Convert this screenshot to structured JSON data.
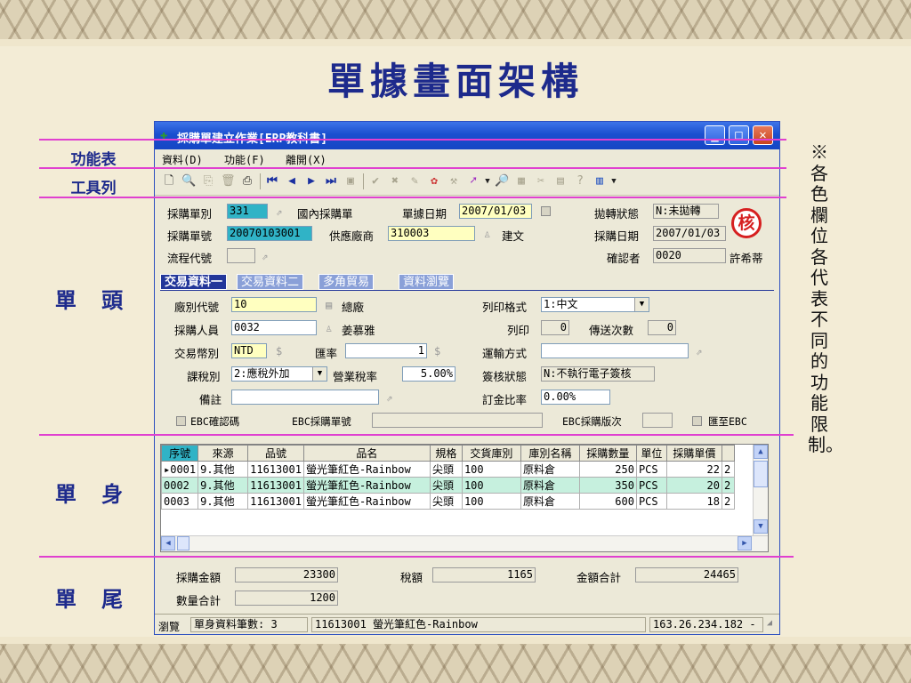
{
  "slide": {
    "title": "單據畫面架構",
    "labels": {
      "menu": "功能表",
      "toolbar": "工具列",
      "header": "單 頭",
      "body": "單 身",
      "footer": "單 尾"
    },
    "note": "※各色欄位各代表不同的功能限制。"
  },
  "window": {
    "title": "採購單建立作業[ERP教科書]",
    "menu": [
      "資料(D)",
      "功能(F)",
      "離開(X)"
    ]
  },
  "header": {
    "order_type_label": "採購單別",
    "order_type": "331",
    "order_type_name": "國內採購單",
    "doc_date_label": "單據日期",
    "doc_date": "2007/01/03",
    "transfer_label": "拋轉狀態",
    "transfer": "N:未拋轉",
    "order_no_label": "採購單號",
    "order_no": "20070103001",
    "vendor_label": "供應廠商",
    "vendor": "310003",
    "vendor_name": "建文",
    "purchase_date_label": "採購日期",
    "purchase_date": "2007/01/03",
    "flow_label": "流程代號",
    "flow": "",
    "confirmer_label": "確認者",
    "confirmer": "0020",
    "confirmer_name": "許希蒂",
    "stamp": "核"
  },
  "tabs": [
    "交易資料一",
    "交易資料二",
    "多角貿易",
    "資料瀏覽"
  ],
  "tab1": {
    "factory_label": "廠別代號",
    "factory": "10",
    "factory_name": "總廠",
    "buyer_label": "採購人員",
    "buyer": "0032",
    "buyer_name": "姜慕雅",
    "currency_label": "交易幣別",
    "currency": "NTD",
    "rate_label": "匯率",
    "rate": "1",
    "tax_type_label": "課稅別",
    "tax_type": "2:應稅外加",
    "tax_rate_label": "營業稅率",
    "tax_rate": "5.00%",
    "remark_label": "備註",
    "remark": "",
    "print_format_label": "列印格式",
    "print_format": "1:中文",
    "print_label": "列印",
    "print_count": "0",
    "send_label": "傳送次數",
    "send_count": "0",
    "shipping_label": "運輸方式",
    "shipping": "",
    "sign_label": "簽核狀態",
    "sign": "N:不執行電子簽核",
    "deposit_label": "訂金比率",
    "deposit": "0.00%",
    "ebc_code_label": "EBC確認碼",
    "ebc_no_label": "EBC採購單號",
    "ebc_no": "",
    "ebc_ver_label": "EBC採購版次",
    "ebc_ver": "",
    "ebc_send_label": "匯至EBC"
  },
  "grid": {
    "columns": [
      "序號",
      "來源",
      "品號",
      "品名",
      "規格",
      "交貨庫別",
      "庫別名稱",
      "採購數量",
      "單位",
      "採購單價"
    ],
    "rows": [
      [
        "0001",
        "9.其他",
        "11613001",
        "螢光筆紅色-Rainbow",
        "尖頭",
        "100",
        "原料倉",
        "250",
        "PCS",
        "22",
        "2"
      ],
      [
        "0002",
        "9.其他",
        "11613001",
        "螢光筆紅色-Rainbow",
        "尖頭",
        "100",
        "原料倉",
        "350",
        "PCS",
        "20",
        "2"
      ],
      [
        "0003",
        "9.其他",
        "11613001",
        "螢光筆紅色-Rainbow",
        "尖頭",
        "100",
        "原料倉",
        "600",
        "PCS",
        "18",
        "2"
      ]
    ]
  },
  "footer": {
    "amount_label": "採購金額",
    "amount": "23300",
    "tax_label": "稅額",
    "tax": "1165",
    "total_label": "金額合計",
    "total": "24465",
    "qty_label": "數量合計",
    "qty": "1200"
  },
  "status": {
    "mode": "瀏覽",
    "rows": "單身資料筆數: 3",
    "item": "11613001 螢光筆紅色-Rainbow",
    "ip": "163.26.234.182 -"
  },
  "colors": {
    "accent_blue": "#1d2a8c",
    "teal_field": "#30b3c6",
    "yellow_field": "#ffffc0",
    "divider": "#e040d0"
  }
}
